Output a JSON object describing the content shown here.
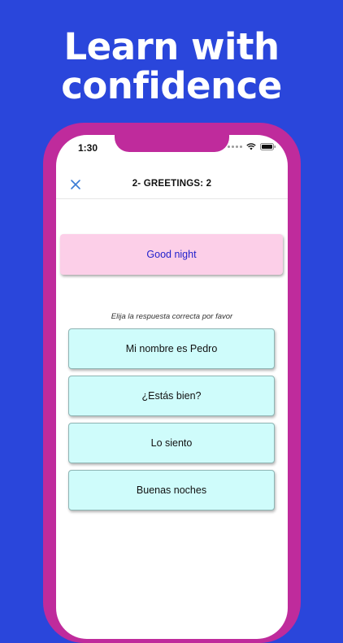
{
  "headline": {
    "line1": "Learn with",
    "line2": "confidence"
  },
  "status_bar": {
    "time": "1:30"
  },
  "nav": {
    "title": "2- GREETINGS: 2",
    "close_icon": "close-icon"
  },
  "quiz": {
    "prompt": "Good night",
    "instruction": "Elija la respuesta correcta por favor",
    "options": [
      "Mi nombre es Pedro",
      "¿Estás bien?",
      "Lo siento",
      "Buenas noches"
    ]
  },
  "colors": {
    "background": "#2a46db",
    "phone_frame": "#bf2b9c",
    "prompt_card": "#fccfe8",
    "prompt_text": "#2222cc",
    "option_card": "#cffcfb",
    "close_icon": "#3a7bd5"
  }
}
